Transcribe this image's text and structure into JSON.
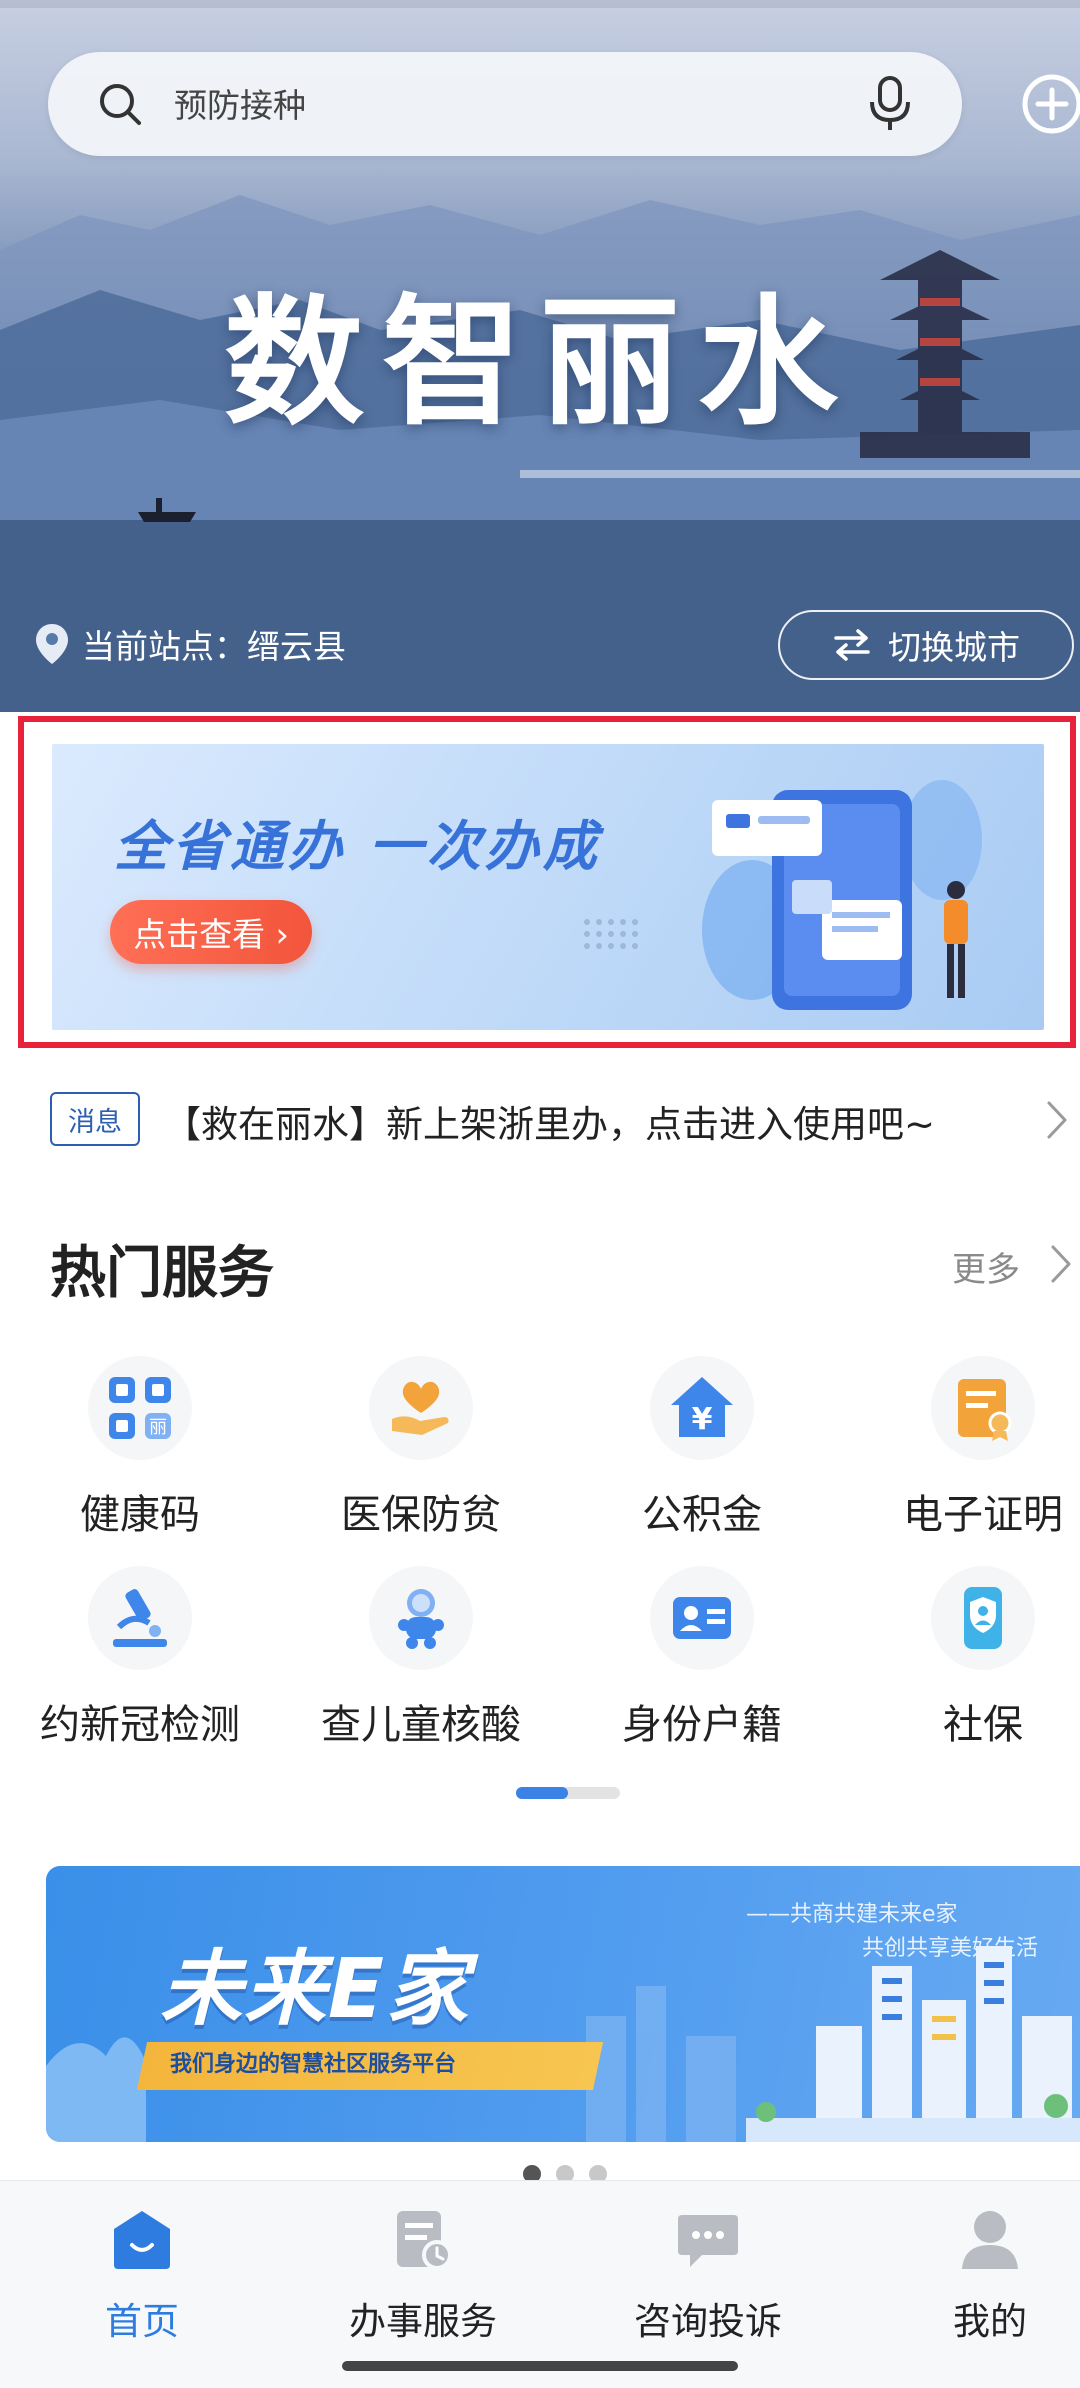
{
  "search": {
    "placeholder": "预防接种"
  },
  "hero": {
    "title": "数智丽水",
    "location_label": "当前站点：缙云县",
    "switch_city_label": "切换城市"
  },
  "promo": {
    "title": "全省通办  一次办成",
    "button_label": "点击查看 ›"
  },
  "notice": {
    "badge": "消息",
    "text": "【救在丽水】新上架浙里办，点击进入使用吧~"
  },
  "hot_services": {
    "title": "热门服务",
    "more_label": "更多",
    "items": [
      {
        "label": "健康码",
        "icon": "qr-code-icon"
      },
      {
        "label": "医保防贫",
        "icon": "heart-hand-icon"
      },
      {
        "label": "公积金",
        "icon": "yuan-house-icon"
      },
      {
        "label": "电子证明",
        "icon": "certificate-icon"
      },
      {
        "label": "约新冠检测",
        "icon": "microscope-icon"
      },
      {
        "label": "查儿童核酸",
        "icon": "baby-icon"
      },
      {
        "label": "身份户籍",
        "icon": "id-card-icon"
      },
      {
        "label": "社保",
        "icon": "social-security-card-icon"
      }
    ],
    "page_indicator": {
      "current": 1,
      "total": 2
    }
  },
  "future_banner": {
    "title": "未来E家",
    "subtitle": "我们身边的智慧社区服务平台",
    "slogan_1": "——共商共建未来e家",
    "slogan_2": "共创共享美好生活",
    "page_indicator": {
      "current": 1,
      "total": 3
    }
  },
  "tabs": [
    {
      "label": "首页",
      "icon": "home-icon",
      "active": true
    },
    {
      "label": "办事服务",
      "icon": "document-clock-icon",
      "active": false
    },
    {
      "label": "咨询投诉",
      "icon": "chat-bubble-icon",
      "active": false
    },
    {
      "label": "我的",
      "icon": "user-icon",
      "active": false
    }
  ],
  "colors": {
    "accent": "#2f7ce0",
    "highlight_frame": "#e8223a",
    "promo_button": "#f2553b"
  }
}
